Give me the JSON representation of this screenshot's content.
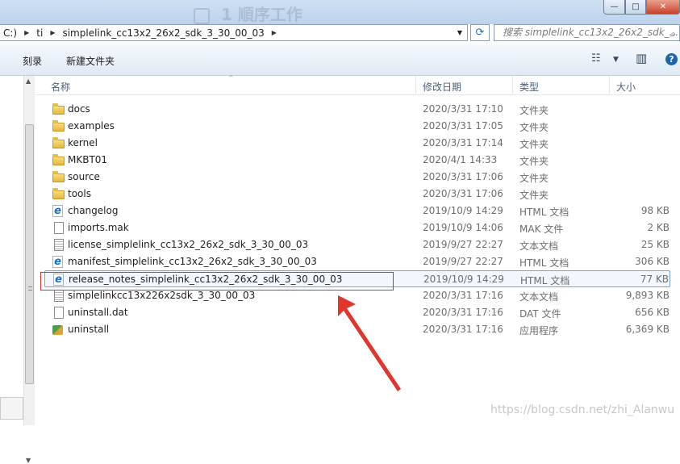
{
  "title_faint": "1 順序工作",
  "window": {
    "minimize_glyph": "—",
    "maximize_glyph": "□",
    "close_glyph": "✕"
  },
  "address": {
    "crumbs": [
      "C:)",
      "ti",
      "simplelink_cc13x2_26x2_sdk_3_30_00_03"
    ],
    "separator_glyph": "▶",
    "dropdown_glyph": "▼",
    "refresh_glyph": "⟳"
  },
  "search": {
    "placeholder": "搜索 simplelink_cc13x2_26x2_sdk_...",
    "icon_glyph": "⌕"
  },
  "toolbar": {
    "burn_label": "刻录",
    "new_folder_label": "新建文件夹",
    "view_glyph": "☷",
    "view_drop_glyph": "▼",
    "pane_glyph": "▥",
    "help_glyph": "?"
  },
  "columns": {
    "name": "名称",
    "date": "修改日期",
    "type": "类型",
    "size": "大小",
    "sort_glyph": "^"
  },
  "files": [
    {
      "icon": "folder-icon",
      "name": "docs",
      "date": "2020/3/31 17:10",
      "type": "文件夹",
      "size": ""
    },
    {
      "icon": "folder-icon",
      "name": "examples",
      "date": "2020/3/31 17:05",
      "type": "文件夹",
      "size": ""
    },
    {
      "icon": "folder-icon",
      "name": "kernel",
      "date": "2020/3/31 17:14",
      "type": "文件夹",
      "size": ""
    },
    {
      "icon": "folder-icon",
      "name": "MKBT01",
      "date": "2020/4/1 14:33",
      "type": "文件夹",
      "size": ""
    },
    {
      "icon": "folder-icon",
      "name": "source",
      "date": "2020/3/31 17:06",
      "type": "文件夹",
      "size": ""
    },
    {
      "icon": "folder-icon",
      "name": "tools",
      "date": "2020/3/31 17:06",
      "type": "文件夹",
      "size": ""
    },
    {
      "icon": "ie-html-icon",
      "name": "changelog",
      "date": "2019/10/9 14:29",
      "type": "HTML 文档",
      "size": "98 KB"
    },
    {
      "icon": "file-icon",
      "name": "imports.mak",
      "date": "2019/10/9 14:06",
      "type": "MAK 文件",
      "size": "2 KB"
    },
    {
      "icon": "text-file-icon",
      "name": "license_simplelink_cc13x2_26x2_sdk_3_30_00_03",
      "date": "2019/9/27 22:27",
      "type": "文本文档",
      "size": "25 KB"
    },
    {
      "icon": "ie-html-icon",
      "name": "manifest_simplelink_cc13x2_26x2_sdk_3_30_00_03",
      "date": "2019/9/27 22:27",
      "type": "HTML 文档",
      "size": "306 KB"
    },
    {
      "icon": "ie-html-icon",
      "name": "release_notes_simplelink_cc13x2_26x2_sdk_3_30_00_03",
      "date": "2019/10/9 14:29",
      "type": "HTML 文档",
      "size": "77 KB"
    },
    {
      "icon": "text-file-icon",
      "name": "simplelinkcc13x226x2sdk_3_30_00_03",
      "date": "2020/3/31 17:16",
      "type": "文本文档",
      "size": "9,893 KB"
    },
    {
      "icon": "file-icon",
      "name": "uninstall.dat",
      "date": "2020/3/31 17:16",
      "type": "DAT 文件",
      "size": "656 KB"
    },
    {
      "icon": "app-icon",
      "name": "uninstall",
      "date": "2020/3/31 17:16",
      "type": "应用程序",
      "size": "6,369 KB"
    }
  ],
  "hover_index": 10,
  "watermark": "https://blog.csdn.net/zhi_Alanwu",
  "colors": {
    "annotation": "#d9342b",
    "selection_border": "#7da2ce"
  }
}
